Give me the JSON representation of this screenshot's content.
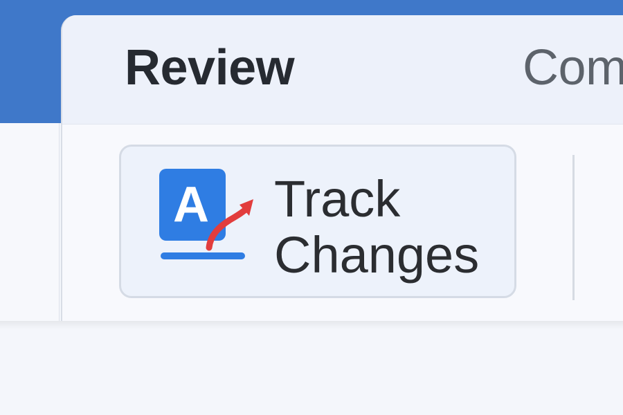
{
  "colors": {
    "title_bar": "#3f78c9",
    "ribbon_bg": "#f8f9fd",
    "tab_strip_bg": "#edf1fa",
    "icon_blue": "#2f7de3",
    "arrow_red": "#e23d3d",
    "text_dark": "#262a31"
  },
  "tabs": [
    {
      "label": "Review",
      "active": true
    },
    {
      "label": "Com"
    }
  ],
  "ribbon": {
    "track_changes": {
      "label": "Track\nChanges",
      "icon": "track-changes-icon"
    }
  }
}
